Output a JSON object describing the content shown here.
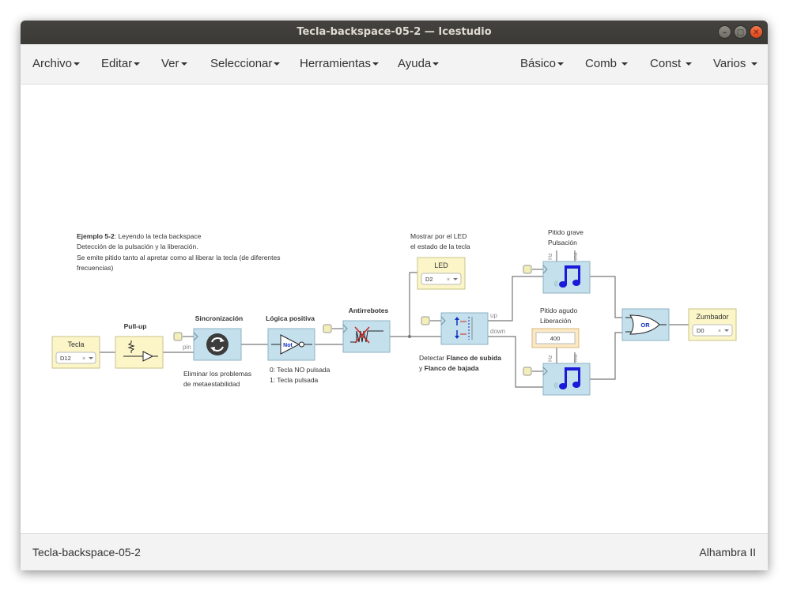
{
  "window": {
    "title": "Tecla-backspace-05-2 — Icestudio"
  },
  "menu": {
    "left": [
      "Archivo",
      "Editar",
      "Ver",
      "Seleccionar",
      "Herramientas",
      "Ayuda"
    ],
    "right": [
      "Básico",
      "Comb",
      "Const",
      "Varios"
    ]
  },
  "notes": {
    "example_bold": "Ejemplo 5-2",
    "example_rest": ": Leyendo la tecla backspace",
    "line2": "Detección de la pulsación y la liberación.",
    "line3": "Se emite pitido tanto al apretar como al liberar la tecla (de diferentes",
    "line4": "frecuencias)",
    "sync_note_1": "Eliminar los problemas",
    "sync_note_2": "de metaestabilidad",
    "logic_note_1": "0: Tecla NO pulsada",
    "logic_note_2": "1: Tecla pulsada",
    "led_note_1": "Mostrar por el LED",
    "led_note_2": "el estado de la tecla",
    "edge_note_1a": "Detectar ",
    "edge_note_1b": "Flanco de subida",
    "edge_note_2a": "y ",
    "edge_note_2b": "Flanco de bajada",
    "grave_1": "Pitido grave",
    "grave_2": "Pulsación",
    "agudo_1": "Pitido agudo",
    "agudo_2": "Liberación"
  },
  "blocks": {
    "input_label": "Tecla",
    "input_pin": "D12",
    "pullup_title": "Pull-up",
    "sync_title": "Sincronización",
    "not_title": "Lógica positiva",
    "not_label": "Not",
    "debounce_title": "Antirrebotes",
    "led_label": "LED",
    "led_pin": "D2",
    "edge_up": "up",
    "edge_down": "down",
    "pin_label": "pin",
    "hz": "Hz",
    "ms": "ms",
    "const_value": "400",
    "or_label": "OR",
    "buzzer_label": "Zumbador",
    "buzzer_pin": "D0"
  },
  "status": {
    "file": "Tecla-backspace-05-2",
    "board": "Alhambra II"
  },
  "colors": {
    "yellow": "#fbf5c8",
    "blue": "#c3e0ec",
    "wire": "#777777"
  }
}
